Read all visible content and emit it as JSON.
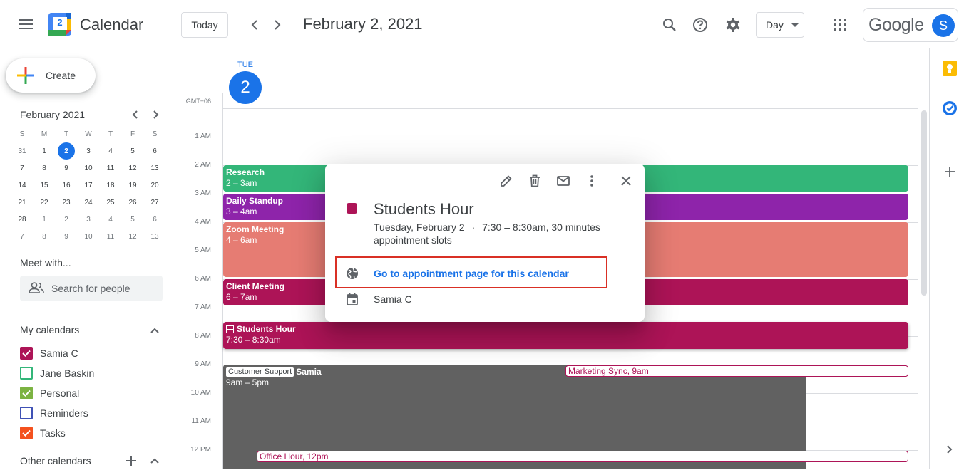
{
  "header": {
    "app_title": "Calendar",
    "logo_day": "2",
    "today_label": "Today",
    "date_title": "February 2, 2021",
    "view_label": "Day",
    "google_label": "Google",
    "avatar_initial": "S"
  },
  "sidebar": {
    "create_label": "Create",
    "mini_month": "February 2021",
    "weekday_heads": [
      "S",
      "M",
      "T",
      "W",
      "T",
      "F",
      "S"
    ],
    "weeks": [
      [
        "31",
        "1",
        "2",
        "3",
        "4",
        "5",
        "6"
      ],
      [
        "7",
        "8",
        "9",
        "10",
        "11",
        "12",
        "13"
      ],
      [
        "14",
        "15",
        "16",
        "17",
        "18",
        "19",
        "20"
      ],
      [
        "21",
        "22",
        "23",
        "24",
        "25",
        "26",
        "27"
      ],
      [
        "28",
        "1",
        "2",
        "3",
        "4",
        "5",
        "6"
      ],
      [
        "7",
        "8",
        "9",
        "10",
        "11",
        "12",
        "13"
      ]
    ],
    "meet_title": "Meet with...",
    "search_people_placeholder": "Search for people",
    "my_calendars_title": "My calendars",
    "my_calendars": [
      {
        "name": "Samia C",
        "color": "#ad1457",
        "checked": true
      },
      {
        "name": "Jane Baskin",
        "color": "#33b679",
        "checked": false
      },
      {
        "name": "Personal",
        "color": "#7cb342",
        "checked": true
      },
      {
        "name": "Reminders",
        "color": "#3f51b5",
        "checked": false
      },
      {
        "name": "Tasks",
        "color": "#f4511e",
        "checked": true
      }
    ],
    "other_calendars_title": "Other calendars"
  },
  "day_header": {
    "weekday": "TUE",
    "day_num": "2",
    "timezone": "GMT+06"
  },
  "hours": [
    "1 AM",
    "2 AM",
    "3 AM",
    "4 AM",
    "5 AM",
    "6 AM",
    "7 AM",
    "8 AM",
    "9 AM",
    "10 AM",
    "11 AM",
    "12 PM"
  ],
  "events": {
    "research": {
      "title": "Research",
      "time": "2 – 3am",
      "color": "#33b679"
    },
    "standup": {
      "title": "Daily Standup",
      "time": "3 – 4am",
      "color": "#8e24aa"
    },
    "zoom": {
      "title": "Zoom Meeting",
      "time": "4 – 6am",
      "color": "#e67c73"
    },
    "client": {
      "title": "Client Meeting",
      "time": "6 – 7am",
      "color": "#ad1457"
    },
    "students": {
      "title": "Students Hour",
      "time": "7:30 – 8:30am",
      "color": "#ad1457"
    },
    "samia": {
      "tag": "Customer Support",
      "title": "Samia",
      "time": "9am – 5pm",
      "color": "#616161"
    },
    "marketing": {
      "title": "Marketing Sync",
      "time": ", 9am"
    },
    "office": {
      "title": "Office Hour",
      "time": ", 12pm"
    }
  },
  "popup": {
    "title": "Students Hour",
    "date_line": "Tuesday, February 2",
    "dot": "·",
    "time_line": "7:30 – 8:30am, 30 minutes",
    "subline": "appointment slots",
    "link_label": "Go to appointment page for this calendar",
    "calendar_name": "Samia C",
    "color": "#ad1457"
  },
  "colors": {
    "accent": "#1a73e8",
    "highlight_box": "#d93025"
  }
}
